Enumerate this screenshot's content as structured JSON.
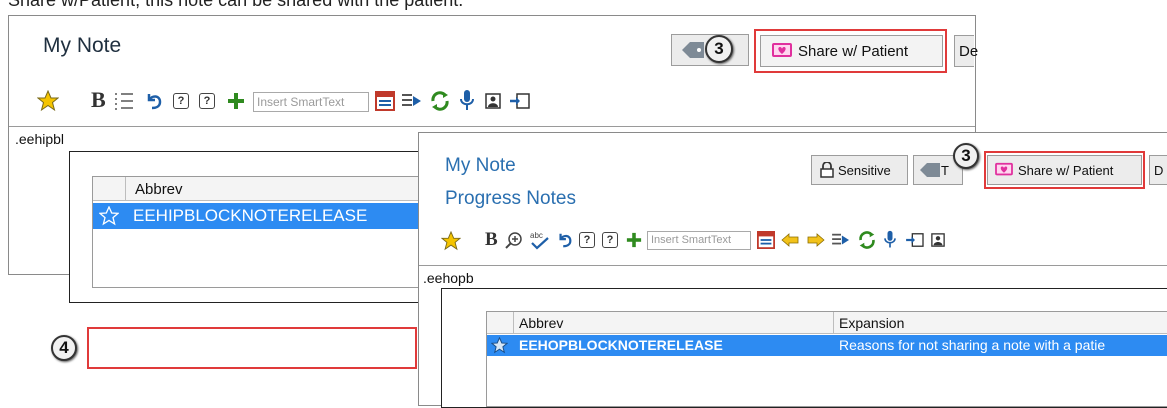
{
  "caption": "Share w/Patient, this note can be shared with the patient.",
  "colors": {
    "selection": "#2d8bf2",
    "highlight": "#e03a3a",
    "share_icon": "#e0309e"
  },
  "back_window": {
    "title": "My Note",
    "tag_badge": "3",
    "share_button": "Share w/ Patient",
    "cut_button": "De",
    "smarttext_placeholder": "Insert SmartText",
    "text": ".eehipbl",
    "column_header": "Abbrev",
    "row_badge": "4",
    "row_value": "EEHIPBLOCKNOTERELEASE"
  },
  "front_window": {
    "title": "My Note",
    "subtitle": "Progress Notes",
    "sensitive_button": "Sensitive",
    "tag_button": "T",
    "share_badge": "3",
    "share_button": "Share w/ Patient",
    "cut_button": "D",
    "smarttext_placeholder": "Insert SmartText",
    "text": ".eehopb",
    "columns": [
      "Abbrev",
      "Expansion"
    ],
    "row": {
      "abbrev": "EEHOPBLOCKNOTERELEASE",
      "expansion": "Reasons for not sharing a note with a patie"
    }
  }
}
